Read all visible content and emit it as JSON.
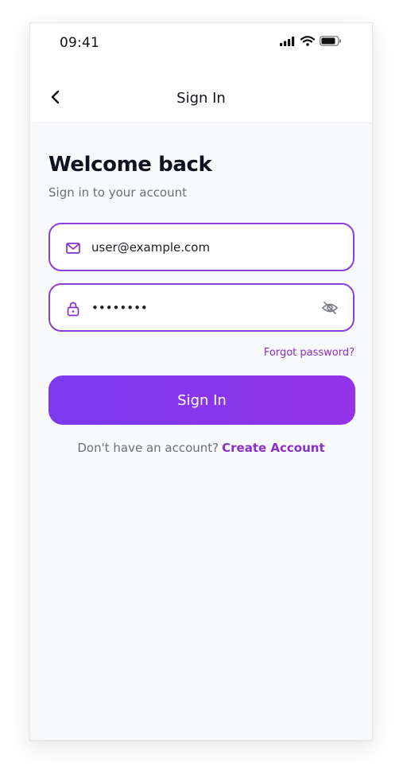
{
  "status_bar": {
    "time": "09:41",
    "icons": [
      "signal-icon",
      "wifi-icon",
      "battery-icon"
    ]
  },
  "nav": {
    "back_icon": "chevron-left-icon",
    "title": "Sign In"
  },
  "header": {
    "title": "Welcome back",
    "subtitle": "Sign in to your account"
  },
  "form": {
    "email": {
      "icon": "mail-icon",
      "value": "user@example.com"
    },
    "password": {
      "icon": "lock-icon",
      "value": "secret12",
      "visibility_icon": "eye-off-icon"
    },
    "forgot_label": "Forgot password?",
    "submit_label": "Sign In"
  },
  "footer": {
    "prompt": "Don't have an account?",
    "link_label": "Create Account"
  },
  "colors": {
    "accent": "#8a2fc9",
    "button_gradient_start": "#7c3aed",
    "button_gradient_end": "#9333ea",
    "field_border": "#8a3fd8",
    "heading": "#0f1220",
    "muted": "#6b6f78"
  }
}
